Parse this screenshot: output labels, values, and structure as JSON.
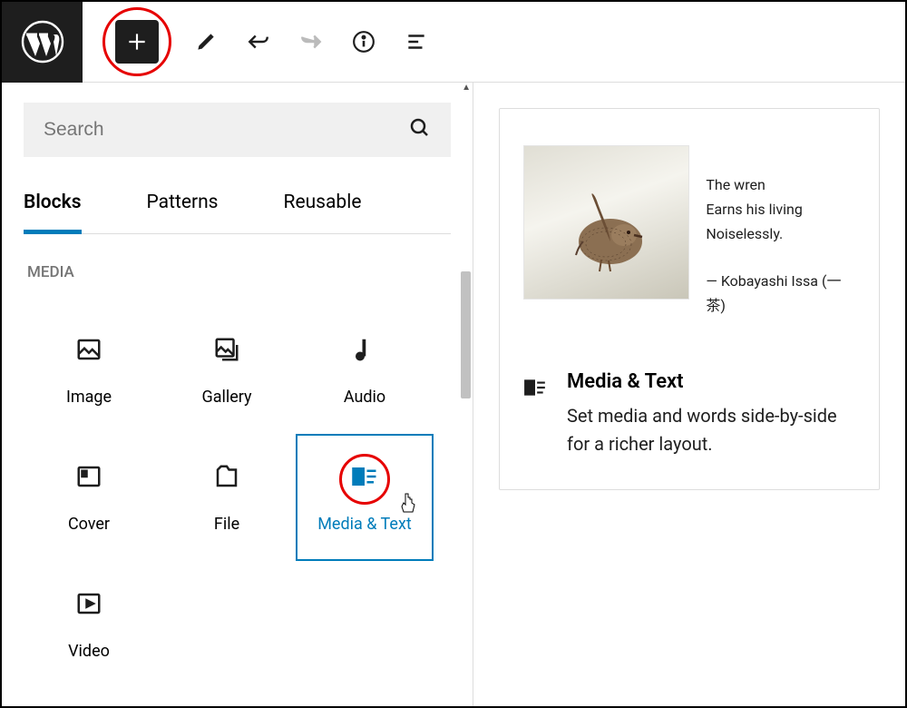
{
  "toolbar": {
    "add_highlight": true
  },
  "search": {
    "placeholder": "Search"
  },
  "tabs": [
    {
      "label": "Blocks",
      "active": true
    },
    {
      "label": "Patterns",
      "active": false
    },
    {
      "label": "Reusable",
      "active": false
    }
  ],
  "section": {
    "label": "MEDIA"
  },
  "blocks": [
    {
      "label": "Image",
      "icon": "image-icon",
      "selected": false
    },
    {
      "label": "Gallery",
      "icon": "gallery-icon",
      "selected": false
    },
    {
      "label": "Audio",
      "icon": "audio-icon",
      "selected": false
    },
    {
      "label": "Cover",
      "icon": "cover-icon",
      "selected": false
    },
    {
      "label": "File",
      "icon": "file-icon",
      "selected": false
    },
    {
      "label": "Media & Text",
      "icon": "media-text-icon",
      "selected": true
    },
    {
      "label": "Video",
      "icon": "video-icon",
      "selected": false
    }
  ],
  "preview": {
    "poem": {
      "line1": "The wren",
      "line2": "Earns his living",
      "line3": "Noiselessly.",
      "attribution": "— Kobayashi Issa (一茶)"
    },
    "title": "Media & Text",
    "description": "Set media and words side-by-side for a richer layout."
  }
}
